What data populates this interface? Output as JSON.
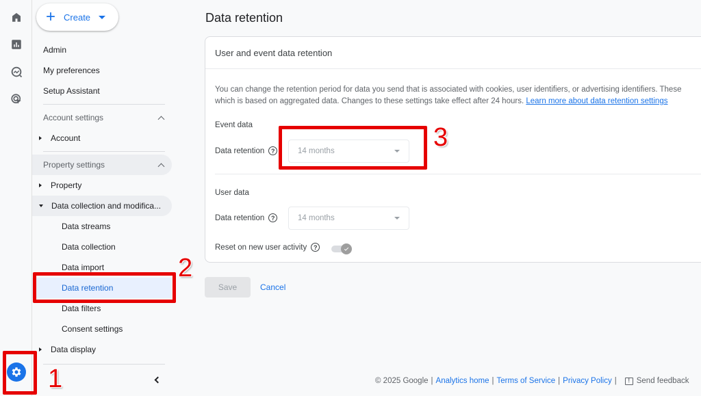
{
  "rail": {
    "items": [
      {
        "icon": "home-icon"
      },
      {
        "icon": "reports-icon"
      },
      {
        "icon": "explore-icon"
      },
      {
        "icon": "advertising-icon"
      }
    ],
    "admin_icon": "gear-icon"
  },
  "sidebar": {
    "create_label": "Create",
    "top_items": [
      "Admin",
      "My preferences",
      "Setup Assistant"
    ],
    "account_settings_label": "Account settings",
    "account_label": "Account",
    "property_settings_label": "Property settings",
    "property_label": "Property",
    "data_collection_label": "Data collection and modifica...",
    "sub_items": [
      "Data streams",
      "Data collection",
      "Data import",
      "Data retention",
      "Data filters",
      "Consent settings"
    ],
    "selected_item": "Data retention",
    "data_display_label": "Data display"
  },
  "main": {
    "title": "Data retention",
    "card_title": "User and event data retention",
    "description_line1": "You can change the retention period for data you send that is associated with cookies, user identifiers, or advertising identifiers. These",
    "description_line2": "which is based on aggregated data. Changes to these settings take effect after 24 hours.",
    "learn_more_link": "Learn more about data retention settings",
    "event_data": {
      "heading": "Event data",
      "label": "Data retention",
      "value": "14 months"
    },
    "user_data": {
      "heading": "User data",
      "label": "Data retention",
      "value": "14 months",
      "reset_label": "Reset on new user activity",
      "reset_enabled": true
    },
    "save_label": "Save",
    "cancel_label": "Cancel"
  },
  "footer": {
    "copyright": "© 2025 Google",
    "links": [
      "Analytics home",
      "Terms of Service",
      "Privacy Policy"
    ],
    "feedback_label": "Send feedback"
  },
  "annotations": {
    "color": "#e60000",
    "labels": [
      "1",
      "2",
      "3"
    ]
  }
}
